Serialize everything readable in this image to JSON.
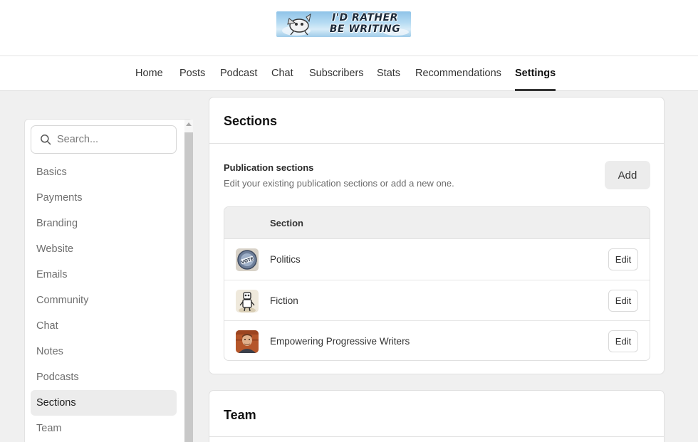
{
  "logo": {
    "line1": "I'D RATHER",
    "line2": "BE WRITING"
  },
  "nav": {
    "items": [
      {
        "id": "home",
        "label": "Home"
      },
      {
        "id": "posts",
        "label": "Posts"
      },
      {
        "id": "podcast",
        "label": "Podcast"
      },
      {
        "id": "chat",
        "label": "Chat"
      },
      {
        "id": "subscribers",
        "label": "Subscribers"
      },
      {
        "id": "stats",
        "label": "Stats"
      },
      {
        "id": "recommendations",
        "label": "Recommendations"
      },
      {
        "id": "settings",
        "label": "Settings"
      }
    ],
    "active": "Settings"
  },
  "sidebar": {
    "search_placeholder": "Search...",
    "items": [
      {
        "label": "Basics"
      },
      {
        "label": "Payments"
      },
      {
        "label": "Branding"
      },
      {
        "label": "Website"
      },
      {
        "label": "Emails"
      },
      {
        "label": "Community"
      },
      {
        "label": "Chat"
      },
      {
        "label": "Notes"
      },
      {
        "label": "Podcasts"
      },
      {
        "label": "Sections"
      },
      {
        "label": "Team"
      }
    ],
    "active": "Sections"
  },
  "sections_card": {
    "title": "Sections",
    "subtitle": "Publication sections",
    "description": "Edit your existing publication sections or add a new one.",
    "add_label": "Add",
    "table": {
      "column": "Section",
      "rows": [
        {
          "name": "Politics",
          "icon": "vote-button-icon",
          "edit_label": "Edit"
        },
        {
          "name": "Fiction",
          "icon": "robot-figure-icon",
          "edit_label": "Edit"
        },
        {
          "name": "Empowering Progressive Writers",
          "icon": "author-photo-icon",
          "edit_label": "Edit"
        }
      ]
    }
  },
  "team_card": {
    "title": "Team"
  },
  "colors": {
    "page_bg": "#f0f0f0",
    "active_item_bg": "#ececec",
    "text_primary": "#222222",
    "text_muted": "#6f6f6f",
    "logo_sky": "#8fc3e8"
  }
}
